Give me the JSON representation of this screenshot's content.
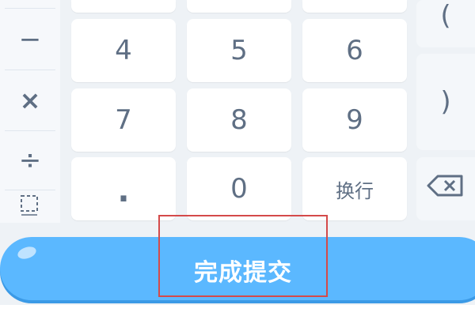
{
  "keypad": {
    "left_column": {
      "minus": "−",
      "multiply": "×",
      "divide": "÷"
    },
    "digits": {
      "four": "4",
      "five": "5",
      "six": "6",
      "seven": "7",
      "eight": "8",
      "nine": "9",
      "dot": ".",
      "zero": "0"
    },
    "newline_label": "换行",
    "right_column": {
      "open_paren": "(",
      "close_paren": ")"
    }
  },
  "submit_button_label": "完成提交",
  "icons": {
    "selection": "dashed-square-icon",
    "backspace": "backspace-icon"
  },
  "colors": {
    "submit_button": "#5bb8ff",
    "key_text": "#5f6f84",
    "highlight_box": "#d44a4a"
  }
}
